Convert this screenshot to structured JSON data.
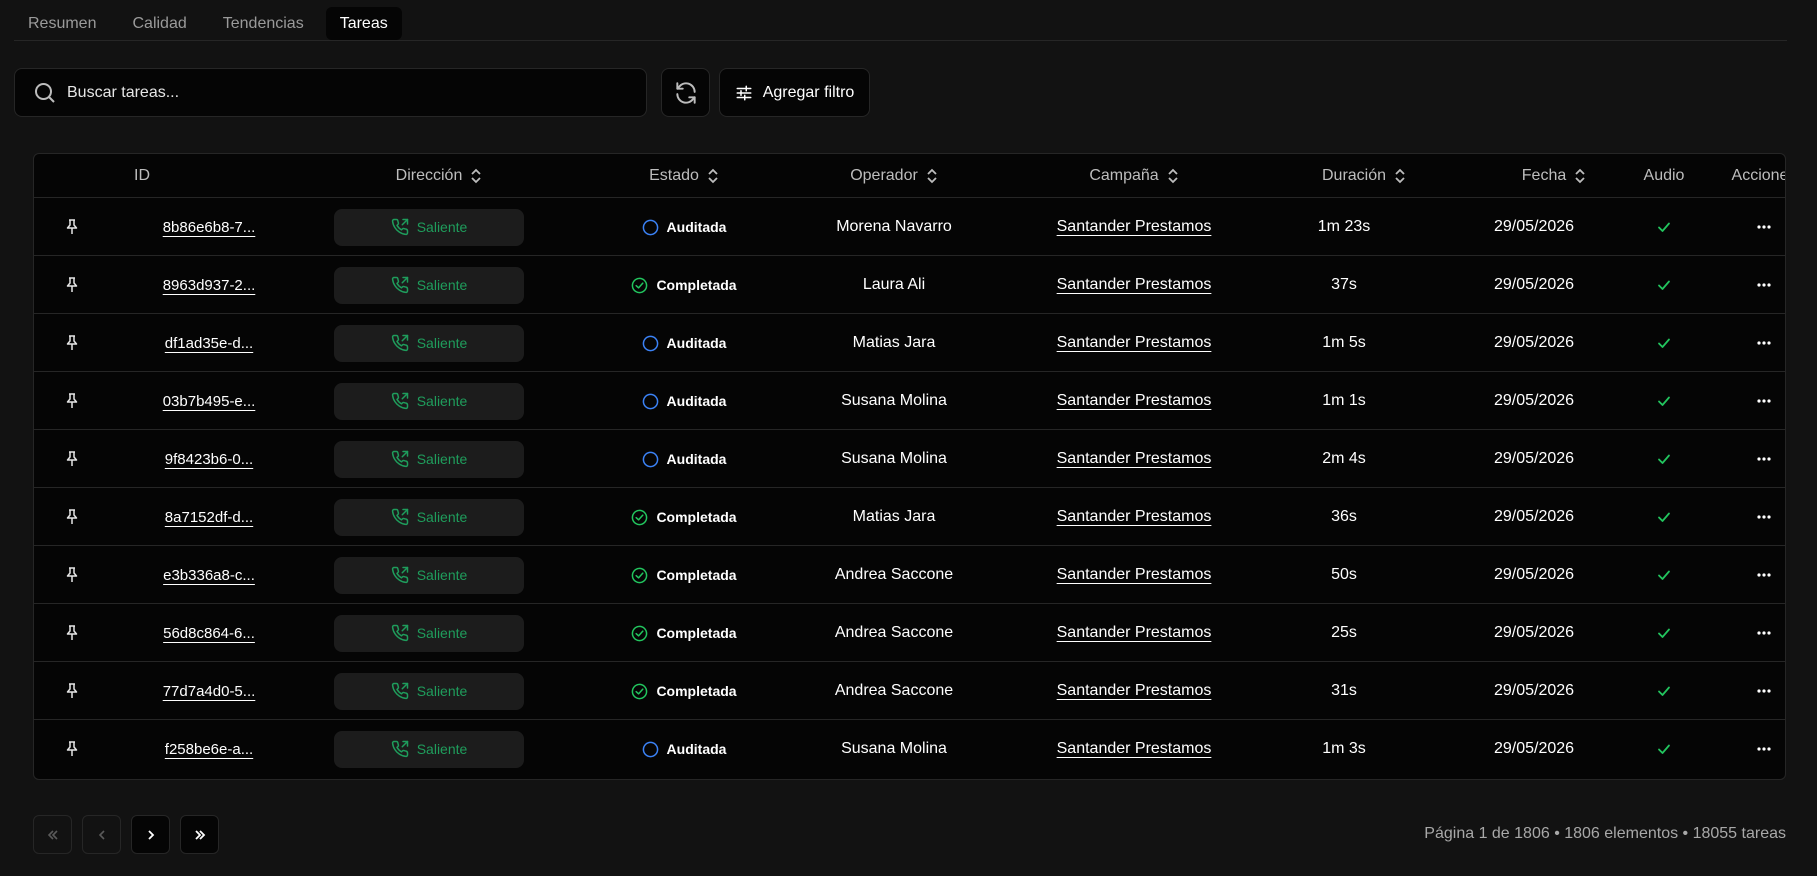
{
  "tabs": [
    {
      "label": "Resumen",
      "active": false
    },
    {
      "label": "Calidad",
      "active": false
    },
    {
      "label": "Tendencias",
      "active": false
    },
    {
      "label": "Tareas",
      "active": true
    }
  ],
  "search": {
    "placeholder": "Buscar tareas...",
    "value": ""
  },
  "toolbar": {
    "filter_label": "Agregar filtro",
    "refresh_icon": "refresh-icon",
    "filter_icon": "sliders-icon"
  },
  "columns": {
    "id": "ID",
    "direction": "Dirección",
    "status": "Estado",
    "operator": "Operador",
    "campaign": "Campaña",
    "duration": "Duración",
    "date": "Fecha",
    "audio": "Audio",
    "actions": "Acciones"
  },
  "colors": {
    "completed": "#22c55e",
    "audited": "#3b82f6",
    "outgoing": "#1f9d5c",
    "audio": "#22c55e"
  },
  "rows": [
    {
      "id": "8b86e6b8-7...",
      "direction": "Saliente",
      "status": "Auditada",
      "status_kind": "audited",
      "operator": "Morena Navarro",
      "campaign": "Santander Prestamos",
      "duration": "1m 23s",
      "date": "29/05/2026",
      "audio": true
    },
    {
      "id": "8963d937-2...",
      "direction": "Saliente",
      "status": "Completada",
      "status_kind": "completed",
      "operator": "Laura Ali",
      "campaign": "Santander Prestamos",
      "duration": "37s",
      "date": "29/05/2026",
      "audio": true
    },
    {
      "id": "df1ad35e-d...",
      "direction": "Saliente",
      "status": "Auditada",
      "status_kind": "audited",
      "operator": "Matias Jara",
      "campaign": "Santander Prestamos",
      "duration": "1m 5s",
      "date": "29/05/2026",
      "audio": true
    },
    {
      "id": "03b7b495-e...",
      "direction": "Saliente",
      "status": "Auditada",
      "status_kind": "audited",
      "operator": "Susana Molina",
      "campaign": "Santander Prestamos",
      "duration": "1m 1s",
      "date": "29/05/2026",
      "audio": true
    },
    {
      "id": "9f8423b6-0...",
      "direction": "Saliente",
      "status": "Auditada",
      "status_kind": "audited",
      "operator": "Susana Molina",
      "campaign": "Santander Prestamos",
      "duration": "2m 4s",
      "date": "29/05/2026",
      "audio": true
    },
    {
      "id": "8a7152df-d...",
      "direction": "Saliente",
      "status": "Completada",
      "status_kind": "completed",
      "operator": "Matias Jara",
      "campaign": "Santander Prestamos",
      "duration": "36s",
      "date": "29/05/2026",
      "audio": true
    },
    {
      "id": "e3b336a8-c...",
      "direction": "Saliente",
      "status": "Completada",
      "status_kind": "completed",
      "operator": "Andrea Saccone",
      "campaign": "Santander Prestamos",
      "duration": "50s",
      "date": "29/05/2026",
      "audio": true
    },
    {
      "id": "56d8c864-6...",
      "direction": "Saliente",
      "status": "Completada",
      "status_kind": "completed",
      "operator": "Andrea Saccone",
      "campaign": "Santander Prestamos",
      "duration": "25s",
      "date": "29/05/2026",
      "audio": true
    },
    {
      "id": "77d7a4d0-5...",
      "direction": "Saliente",
      "status": "Completada",
      "status_kind": "completed",
      "operator": "Andrea Saccone",
      "campaign": "Santander Prestamos",
      "duration": "31s",
      "date": "29/05/2026",
      "audio": true
    },
    {
      "id": "f258be6e-a...",
      "direction": "Saliente",
      "status": "Auditada",
      "status_kind": "audited",
      "operator": "Susana Molina",
      "campaign": "Santander Prestamos",
      "duration": "1m 3s",
      "date": "29/05/2026",
      "audio": true
    }
  ],
  "pagination": {
    "info": "Página 1 de 1806 • 1806 elementos • 18055 tareas"
  }
}
